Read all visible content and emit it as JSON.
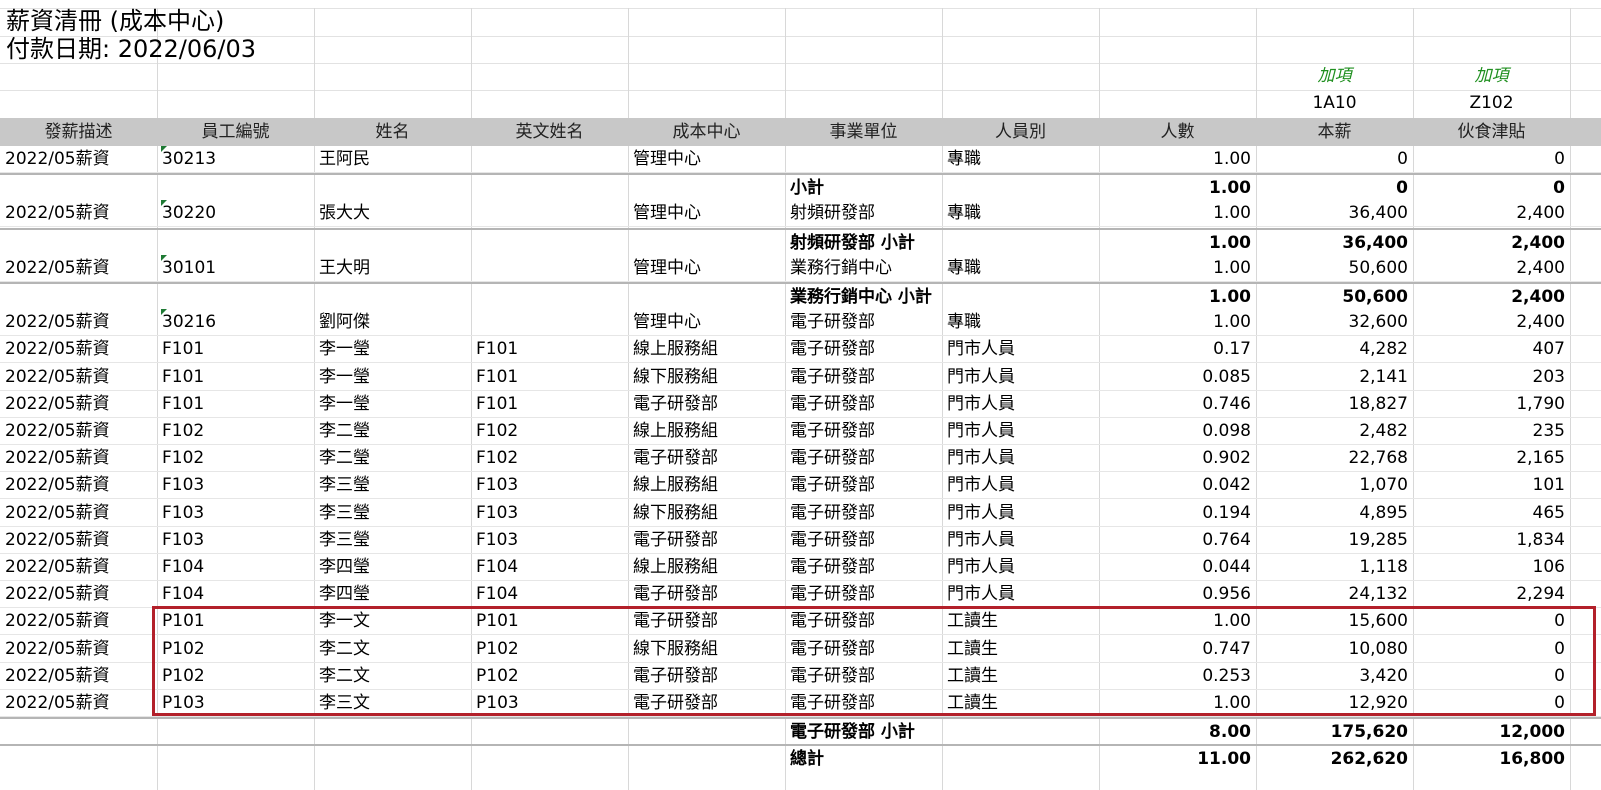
{
  "sheet": {
    "title_line1": "薪資清冊 (成本中心)",
    "title_line2": "付款日期: 2022/06/03",
    "item_labels": [
      "加項",
      "加項"
    ],
    "code_labels": [
      "1A10",
      "Z102"
    ],
    "columns": [
      "發薪描述",
      "員工編號",
      "姓名",
      "英文姓名",
      "成本中心",
      "事業單位",
      "人員別",
      "人數",
      "本薪",
      "伙食津貼"
    ],
    "colors": {
      "header_bg": "#c8c8c8",
      "item_label": "#1f8f1f",
      "highlight": "#b3202a",
      "comment_marker": "#1e7a34"
    },
    "rows": [
      {
        "type": "data",
        "desc": "2022/05薪資",
        "id": "30213",
        "name": "王阿民",
        "en": "",
        "cc": "管理中心",
        "bu": "",
        "cat": "專職",
        "hc": "1.00",
        "base": "0",
        "meal": "0",
        "marker": true
      },
      {
        "type": "subtotal",
        "desc": "",
        "id": "",
        "name": "",
        "en": "",
        "cc": "",
        "bu": "小計",
        "cat": "",
        "hc": "1.00",
        "base": "0",
        "meal": "0"
      },
      {
        "type": "data",
        "desc": "2022/05薪資",
        "id": "30220",
        "name": "張大大",
        "en": "",
        "cc": "管理中心",
        "bu": "射頻研發部",
        "cat": "專職",
        "hc": "1.00",
        "base": "36,400",
        "meal": "2,400",
        "marker": true
      },
      {
        "type": "subtotal",
        "desc": "",
        "id": "",
        "name": "",
        "en": "",
        "cc": "",
        "bu": "射頻研發部 小計",
        "cat": "",
        "hc": "1.00",
        "base": "36,400",
        "meal": "2,400"
      },
      {
        "type": "data",
        "desc": "2022/05薪資",
        "id": "30101",
        "name": "王大明",
        "en": "",
        "cc": "管理中心",
        "bu": "業務行銷中心",
        "cat": "專職",
        "hc": "1.00",
        "base": "50,600",
        "meal": "2,400",
        "marker": true
      },
      {
        "type": "subtotal",
        "desc": "",
        "id": "",
        "name": "",
        "en": "",
        "cc": "",
        "bu": "業務行銷中心 小計",
        "cat": "",
        "hc": "1.00",
        "base": "50,600",
        "meal": "2,400"
      },
      {
        "type": "data",
        "desc": "2022/05薪資",
        "id": "30216",
        "name": "劉阿傑",
        "en": "",
        "cc": "管理中心",
        "bu": "電子研發部",
        "cat": "專職",
        "hc": "1.00",
        "base": "32,600",
        "meal": "2,400",
        "marker": true
      },
      {
        "type": "data",
        "desc": "2022/05薪資",
        "id": "F101",
        "name": "李一瑩",
        "en": "F101",
        "cc": "線上服務組",
        "bu": "電子研發部",
        "cat": "門市人員",
        "hc": "0.17",
        "base": "4,282",
        "meal": "407"
      },
      {
        "type": "data",
        "desc": "2022/05薪資",
        "id": "F101",
        "name": "李一瑩",
        "en": "F101",
        "cc": "線下服務組",
        "bu": "電子研發部",
        "cat": "門市人員",
        "hc": "0.085",
        "base": "2,141",
        "meal": "203"
      },
      {
        "type": "data",
        "desc": "2022/05薪資",
        "id": "F101",
        "name": "李一瑩",
        "en": "F101",
        "cc": "電子研發部",
        "bu": "電子研發部",
        "cat": "門市人員",
        "hc": "0.746",
        "base": "18,827",
        "meal": "1,790"
      },
      {
        "type": "data",
        "desc": "2022/05薪資",
        "id": "F102",
        "name": "李二瑩",
        "en": "F102",
        "cc": "線上服務組",
        "bu": "電子研發部",
        "cat": "門市人員",
        "hc": "0.098",
        "base": "2,482",
        "meal": "235"
      },
      {
        "type": "data",
        "desc": "2022/05薪資",
        "id": "F102",
        "name": "李二瑩",
        "en": "F102",
        "cc": "電子研發部",
        "bu": "電子研發部",
        "cat": "門市人員",
        "hc": "0.902",
        "base": "22,768",
        "meal": "2,165"
      },
      {
        "type": "data",
        "desc": "2022/05薪資",
        "id": "F103",
        "name": "李三瑩",
        "en": "F103",
        "cc": "線上服務組",
        "bu": "電子研發部",
        "cat": "門市人員",
        "hc": "0.042",
        "base": "1,070",
        "meal": "101"
      },
      {
        "type": "data",
        "desc": "2022/05薪資",
        "id": "F103",
        "name": "李三瑩",
        "en": "F103",
        "cc": "線下服務組",
        "bu": "電子研發部",
        "cat": "門市人員",
        "hc": "0.194",
        "base": "4,895",
        "meal": "465"
      },
      {
        "type": "data",
        "desc": "2022/05薪資",
        "id": "F103",
        "name": "李三瑩",
        "en": "F103",
        "cc": "電子研發部",
        "bu": "電子研發部",
        "cat": "門市人員",
        "hc": "0.764",
        "base": "19,285",
        "meal": "1,834"
      },
      {
        "type": "data",
        "desc": "2022/05薪資",
        "id": "F104",
        "name": "李四瑩",
        "en": "F104",
        "cc": "線上服務組",
        "bu": "電子研發部",
        "cat": "門市人員",
        "hc": "0.044",
        "base": "1,118",
        "meal": "106"
      },
      {
        "type": "data",
        "desc": "2022/05薪資",
        "id": "F104",
        "name": "李四瑩",
        "en": "F104",
        "cc": "電子研發部",
        "bu": "電子研發部",
        "cat": "門市人員",
        "hc": "0.956",
        "base": "24,132",
        "meal": "2,294"
      },
      {
        "type": "data",
        "desc": "2022/05薪資",
        "id": "P101",
        "name": "李一文",
        "en": "P101",
        "cc": "電子研發部",
        "bu": "電子研發部",
        "cat": "工讀生",
        "hc": "1.00",
        "base": "15,600",
        "meal": "0"
      },
      {
        "type": "data",
        "desc": "2022/05薪資",
        "id": "P102",
        "name": "李二文",
        "en": "P102",
        "cc": "線下服務組",
        "bu": "電子研發部",
        "cat": "工讀生",
        "hc": "0.747",
        "base": "10,080",
        "meal": "0"
      },
      {
        "type": "data",
        "desc": "2022/05薪資",
        "id": "P102",
        "name": "李二文",
        "en": "P102",
        "cc": "電子研發部",
        "bu": "電子研發部",
        "cat": "工讀生",
        "hc": "0.253",
        "base": "3,420",
        "meal": "0"
      },
      {
        "type": "data",
        "desc": "2022/05薪資",
        "id": "P103",
        "name": "李三文",
        "en": "P103",
        "cc": "電子研發部",
        "bu": "電子研發部",
        "cat": "工讀生",
        "hc": "1.00",
        "base": "12,920",
        "meal": "0"
      },
      {
        "type": "subtotal",
        "desc": "",
        "id": "",
        "name": "",
        "en": "",
        "cc": "",
        "bu": "電子研發部 小計",
        "cat": "",
        "hc": "8.00",
        "base": "175,620",
        "meal": "12,000"
      },
      {
        "type": "subtotal",
        "desc": "",
        "id": "",
        "name": "",
        "en": "",
        "cc": "",
        "bu": "總計",
        "cat": "",
        "hc": "11.00",
        "base": "262,620",
        "meal": "16,800"
      }
    ]
  }
}
